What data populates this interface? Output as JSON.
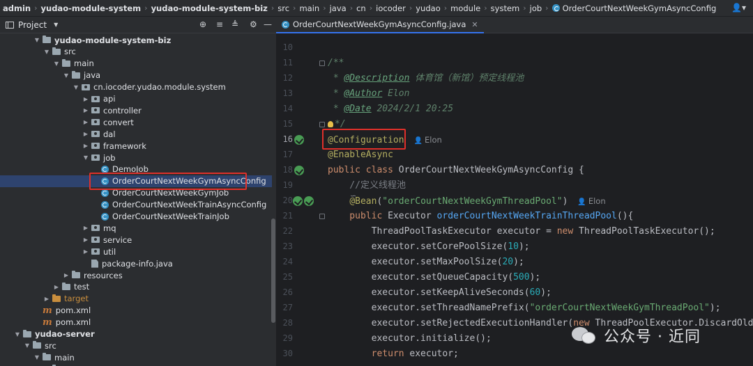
{
  "breadcrumb": [
    "admin",
    "yudao-module-system",
    "yudao-module-system-biz",
    "src",
    "main",
    "java",
    "cn",
    "iocoder",
    "yudao",
    "module",
    "system",
    "job",
    "OrderCourtNextWeekGymAsyncConfig"
  ],
  "project_panel": {
    "title": "Project",
    "tree": [
      {
        "label": "yudao-module-system-biz",
        "icon": "folder",
        "expanded": true,
        "bold": true
      },
      {
        "label": "src",
        "icon": "folder",
        "expanded": true
      },
      {
        "label": "main",
        "icon": "folder",
        "expanded": true
      },
      {
        "label": "java",
        "icon": "folder",
        "expanded": true
      },
      {
        "label": "cn.iocoder.yudao.module.system",
        "icon": "package",
        "expanded": true
      },
      {
        "label": "api",
        "icon": "package",
        "expanded": false
      },
      {
        "label": "controller",
        "icon": "package",
        "expanded": false
      },
      {
        "label": "convert",
        "icon": "package",
        "expanded": false
      },
      {
        "label": "dal",
        "icon": "package",
        "expanded": false
      },
      {
        "label": "framework",
        "icon": "package",
        "expanded": false
      },
      {
        "label": "job",
        "icon": "package",
        "expanded": true
      },
      {
        "label": "DemoJob",
        "icon": "class"
      },
      {
        "label": "OrderCourtNextWeekGymAsyncConfig",
        "icon": "class",
        "selected": true
      },
      {
        "label": "OrderCourtNextWeekGymJob",
        "icon": "class"
      },
      {
        "label": "OrderCourtNextWeekTrainAsyncConfig",
        "icon": "class"
      },
      {
        "label": "OrderCourtNextWeekTrainJob",
        "icon": "class"
      },
      {
        "label": "mq",
        "icon": "package",
        "expanded": false
      },
      {
        "label": "service",
        "icon": "package",
        "expanded": false
      },
      {
        "label": "util",
        "icon": "package",
        "expanded": false
      },
      {
        "label": "package-info.java",
        "icon": "java-file"
      },
      {
        "label": "resources",
        "icon": "folder",
        "expanded": false
      },
      {
        "label": "test",
        "icon": "folder",
        "expanded": false
      },
      {
        "label": "target",
        "icon": "folder-target",
        "expanded": false
      },
      {
        "label": "pom.xml",
        "icon": "maven"
      },
      {
        "label": "pom.xml",
        "icon": "maven"
      },
      {
        "label": "yudao-server",
        "icon": "folder",
        "expanded": true,
        "bold": true
      },
      {
        "label": "src",
        "icon": "folder",
        "expanded": true
      },
      {
        "label": "main",
        "icon": "folder",
        "expanded": true
      },
      {
        "label": "java",
        "icon": "folder",
        "expanded": true
      }
    ]
  },
  "editor": {
    "tab_label": "OrderCourtNextWeekGymAsyncConfig.java",
    "current_line": 16,
    "lines": [
      {
        "n": 10,
        "tokens": []
      },
      {
        "n": 11,
        "tokens": [
          {
            "t": "/**",
            "c": "cm"
          }
        ]
      },
      {
        "n": 12,
        "tokens": [
          {
            "t": " * ",
            "c": "cm"
          },
          {
            "t": "@Description",
            "c": "tag"
          },
          {
            "t": " 体育馆（新馆）预定线程池",
            "c": "cm"
          }
        ]
      },
      {
        "n": 13,
        "tokens": [
          {
            "t": " * ",
            "c": "cm"
          },
          {
            "t": "@Author",
            "c": "tag"
          },
          {
            "t": " Elon",
            "c": "cm"
          }
        ]
      },
      {
        "n": 14,
        "tokens": [
          {
            "t": " * ",
            "c": "cm"
          },
          {
            "t": "@Date",
            "c": "tag"
          },
          {
            "t": " 2024/2/1 20:25",
            "c": "cm"
          }
        ]
      },
      {
        "n": 15,
        "tokens": [
          {
            "t": " */",
            "c": "cm"
          }
        ]
      },
      {
        "n": 16,
        "tokens": [
          {
            "t": "@Configuration",
            "c": "ann"
          }
        ]
      },
      {
        "n": 17,
        "tokens": [
          {
            "t": "@EnableAsync",
            "c": "ann"
          }
        ]
      },
      {
        "n": 18,
        "tokens": [
          {
            "t": "public class ",
            "c": "kw"
          },
          {
            "t": "OrderCourtNextWeekGymAsyncConfig {",
            "c": "p"
          }
        ]
      },
      {
        "n": 19,
        "tokens": [
          {
            "t": "    //定义线程池",
            "c": "lc"
          }
        ]
      },
      {
        "n": 20,
        "tokens": [
          {
            "t": "    ",
            "c": "p"
          },
          {
            "t": "@Bean",
            "c": "ann"
          },
          {
            "t": "(",
            "c": "p"
          },
          {
            "t": "\"orderCourtNextWeekGymThreadPool\"",
            "c": "str"
          },
          {
            "t": ")",
            "c": "p"
          }
        ]
      },
      {
        "n": 21,
        "tokens": [
          {
            "t": "    public ",
            "c": "kw"
          },
          {
            "t": "Executor ",
            "c": "p"
          },
          {
            "t": "orderCourtNextWeekTrainThreadPool",
            "c": "fn"
          },
          {
            "t": "(){",
            "c": "p"
          }
        ]
      },
      {
        "n": 22,
        "tokens": [
          {
            "t": "        ThreadPoolTaskExecutor executor = ",
            "c": "p"
          },
          {
            "t": "new ",
            "c": "kw"
          },
          {
            "t": "ThreadPoolTaskExecutor();",
            "c": "p"
          }
        ]
      },
      {
        "n": 23,
        "tokens": [
          {
            "t": "        executor.setCorePoolSize(",
            "c": "p"
          },
          {
            "t": "10",
            "c": "num"
          },
          {
            "t": ");",
            "c": "p"
          }
        ]
      },
      {
        "n": 24,
        "tokens": [
          {
            "t": "        executor.setMaxPoolSize(",
            "c": "p"
          },
          {
            "t": "20",
            "c": "num"
          },
          {
            "t": ");",
            "c": "p"
          }
        ]
      },
      {
        "n": 25,
        "tokens": [
          {
            "t": "        executor.setQueueCapacity(",
            "c": "p"
          },
          {
            "t": "500",
            "c": "num"
          },
          {
            "t": ");",
            "c": "p"
          }
        ]
      },
      {
        "n": 26,
        "tokens": [
          {
            "t": "        executor.setKeepAliveSeconds(",
            "c": "p"
          },
          {
            "t": "60",
            "c": "num"
          },
          {
            "t": ");",
            "c": "p"
          }
        ]
      },
      {
        "n": 27,
        "tokens": [
          {
            "t": "        executor.setThreadNamePrefix(",
            "c": "p"
          },
          {
            "t": "\"orderCourtNextWeekGymThreadPool\"",
            "c": "str"
          },
          {
            "t": ");",
            "c": "p"
          }
        ]
      },
      {
        "n": 28,
        "tokens": [
          {
            "t": "        executor.setRejectedExecutionHandler(",
            "c": "p"
          },
          {
            "t": "new ",
            "c": "kw"
          },
          {
            "t": "ThreadPoolExecutor.DiscardOldest",
            "c": "p"
          }
        ]
      },
      {
        "n": 29,
        "tokens": [
          {
            "t": "        executor.initialize();",
            "c": "p"
          }
        ]
      },
      {
        "n": 30,
        "tokens": [
          {
            "t": "        return ",
            "c": "kw"
          },
          {
            "t": "executor;",
            "c": "p"
          }
        ]
      }
    ],
    "inlay_author": "Elon",
    "line19_hint": "∽",
    "line20_author": "Elon"
  },
  "watermark": "公众号 · 近同",
  "colors": {
    "accent": "#3574f0",
    "highlight_box": "#e0302a",
    "selection": "#2e436e"
  }
}
